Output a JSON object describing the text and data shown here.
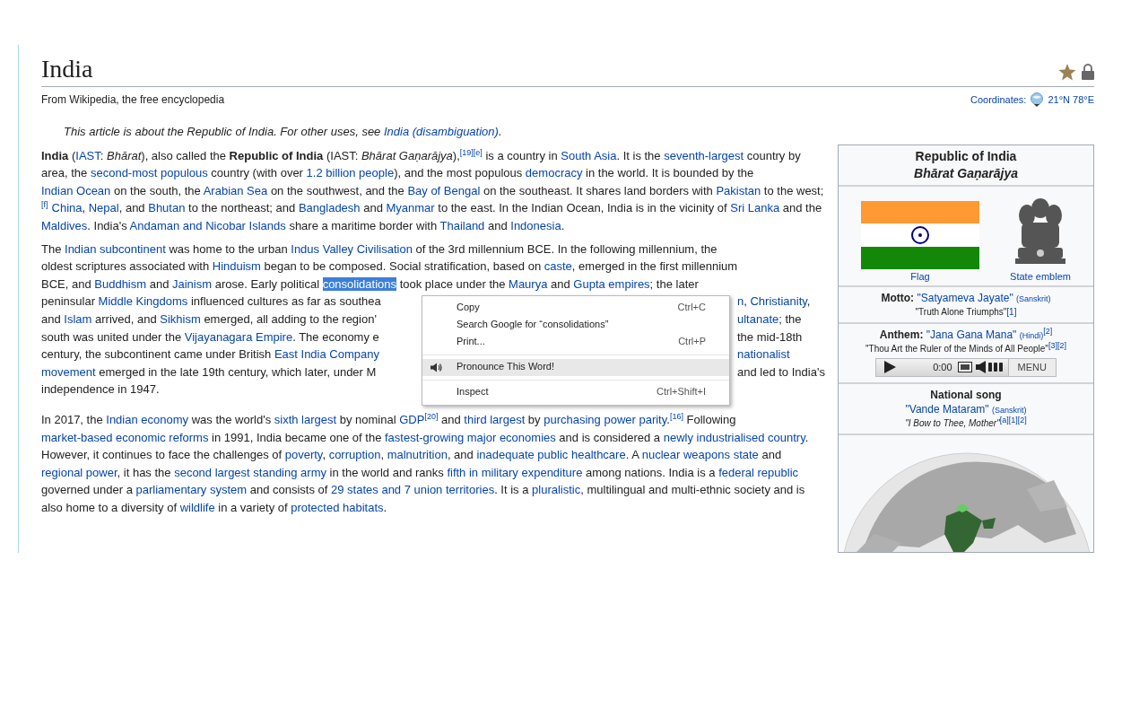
{
  "article": {
    "title": "India",
    "tagline": "From Wikipedia, the free encyclopedia",
    "coordinates": {
      "label": "Coordinates:",
      "value": "21°N 78°E"
    },
    "hatnote": [
      "This article is about the Republic of India. For other uses, see ",
      {
        "kind": "link",
        "text": "India (disambiguation)"
      },
      "."
    ],
    "paragraph_1": [
      {
        "kind": "bold",
        "text": "India"
      },
      " (",
      {
        "kind": "link",
        "text": "IAST"
      },
      ": ",
      {
        "kind": "italic",
        "text": "Bhārat"
      },
      "), also called the ",
      {
        "kind": "bold",
        "text": "Republic of India"
      },
      " (IAST: ",
      {
        "kind": "italic",
        "text": "Bhārat Gaṇarājya"
      },
      "),",
      {
        "kind": "ref",
        "text": "[19][e]"
      },
      " is a country in ",
      {
        "kind": "link",
        "text": "South Asia"
      },
      ". It is the ",
      {
        "kind": "link",
        "text": "seventh-largest"
      },
      " country by area, the ",
      {
        "kind": "link",
        "text": "second-most populous"
      },
      " country (with over ",
      {
        "kind": "link",
        "text": "1.2 billion people"
      },
      "), and the most populous ",
      {
        "kind": "link",
        "text": "democracy"
      },
      " in the world. It is bounded by the ",
      {
        "kind": "link",
        "text": "Indian Ocean"
      },
      " on the south, the ",
      {
        "kind": "link",
        "text": "Arabian Sea"
      },
      " on the southwest, and the ",
      {
        "kind": "link",
        "text": "Bay of Bengal"
      },
      " on the southeast. It shares land borders with ",
      {
        "kind": "link",
        "text": "Pakistan"
      },
      " to the west;",
      {
        "kind": "ref",
        "text": "[f]"
      },
      {
        "kind": "link",
        "text": "China"
      },
      ", ",
      {
        "kind": "link",
        "text": "Nepal"
      },
      ", and ",
      {
        "kind": "link",
        "text": "Bhutan"
      },
      " to the northeast; and ",
      {
        "kind": "link",
        "text": "Bangladesh"
      },
      " and ",
      {
        "kind": "link",
        "text": "Myanmar"
      },
      " to the east. In the Indian Ocean, India is in the vicinity of ",
      {
        "kind": "link",
        "text": "Sri Lanka"
      },
      " and the ",
      {
        "kind": "link",
        "text": "Maldives"
      },
      ". India's ",
      {
        "kind": "link",
        "text": "Andaman and Nicobar Islands"
      },
      " share a maritime border with ",
      {
        "kind": "link",
        "text": "Thailand"
      },
      " and ",
      {
        "kind": "link",
        "text": "Indonesia"
      },
      "."
    ],
    "paragraph_2_lines": [
      {
        "left": [
          "The ",
          {
            "kind": "link",
            "text": "Indian subcontinent"
          },
          " was home to the urban ",
          {
            "kind": "link",
            "text": "Indus Valley Civilisation"
          },
          " of the 3rd millennium BCE. In the following millennium, the"
        ]
      },
      {
        "left": [
          "oldest scriptures associated with ",
          {
            "kind": "link",
            "text": "Hinduism"
          },
          " began to be composed. Social stratification, based on ",
          {
            "kind": "link",
            "text": "caste"
          },
          ", emerged in the first millennium"
        ]
      },
      {
        "left": [
          "BCE, and ",
          {
            "kind": "link",
            "text": "Buddhism"
          },
          " and ",
          {
            "kind": "link",
            "text": "Jainism"
          },
          " arose. Early political ",
          {
            "kind": "selection",
            "text": "consolidations"
          },
          " took place under the ",
          {
            "kind": "link",
            "text": "Maurya"
          },
          " and ",
          {
            "kind": "link",
            "text": "Gupta empires"
          },
          "; the later"
        ]
      },
      {
        "left": [
          "peninsular ",
          {
            "kind": "link",
            "text": "Middle Kingdoms"
          },
          " influenced cultures as far as southea"
        ],
        "right": [
          {
            "kind": "link",
            "text": "n"
          },
          ", ",
          {
            "kind": "link",
            "text": "Christianity"
          },
          ","
        ]
      },
      {
        "left": [
          "and ",
          {
            "kind": "link",
            "text": "Islam"
          },
          " arrived, and ",
          {
            "kind": "link",
            "text": "Sikhism"
          },
          " emerged, all adding to the region'"
        ],
        "right": [
          {
            "kind": "link",
            "text": "ultanate"
          },
          "; the"
        ]
      },
      {
        "left": [
          "south was united under the ",
          {
            "kind": "link",
            "text": "Vijayanagara Empire"
          },
          ". The economy e"
        ],
        "right": [
          "the mid-18th"
        ]
      },
      {
        "left": [
          "century, the subcontinent came under British ",
          {
            "kind": "link",
            "text": "East India Company"
          }
        ],
        "right": [
          {
            "kind": "link",
            "text": "nationalist"
          }
        ]
      },
      {
        "left": [
          {
            "kind": "link",
            "text": "movement"
          },
          " emerged in the late 19th century, which later, under M"
        ],
        "right": [
          "and led to India's"
        ]
      },
      {
        "left": [
          "independence in 1947."
        ]
      }
    ],
    "paragraph_3": [
      "In 2017, the ",
      {
        "kind": "link",
        "text": "Indian economy"
      },
      " was the world's ",
      {
        "kind": "link",
        "text": "sixth largest"
      },
      " by nominal ",
      {
        "kind": "link",
        "text": "GDP"
      },
      {
        "kind": "ref",
        "text": "[20]"
      },
      " and ",
      {
        "kind": "link",
        "text": "third largest"
      },
      " by ",
      {
        "kind": "link",
        "text": "purchasing power parity"
      },
      ".",
      {
        "kind": "ref",
        "text": "[16]"
      },
      " Following ",
      {
        "kind": "link",
        "text": "market-based economic reforms"
      },
      " in 1991, India became one of the ",
      {
        "kind": "link",
        "text": "fastest-growing major economies"
      },
      " and is considered a ",
      {
        "kind": "link",
        "text": "newly industrialised country"
      },
      ". However, it continues to face the challenges of ",
      {
        "kind": "link",
        "text": "poverty"
      },
      ", ",
      {
        "kind": "link",
        "text": "corruption"
      },
      ", ",
      {
        "kind": "link",
        "text": "malnutrition"
      },
      ", and ",
      {
        "kind": "link",
        "text": "inadequate public healthcare"
      },
      ". A ",
      {
        "kind": "link",
        "text": "nuclear weapons state"
      },
      " and ",
      {
        "kind": "link",
        "text": "regional power"
      },
      ", it has the ",
      {
        "kind": "link",
        "text": "second largest standing army"
      },
      " in the world and ranks ",
      {
        "kind": "link",
        "text": "fifth in military expenditure"
      },
      " among nations. India is a ",
      {
        "kind": "link",
        "text": "federal republic"
      },
      " governed under a ",
      {
        "kind": "link",
        "text": "parliamentary system"
      },
      " and consists of ",
      {
        "kind": "link",
        "text": "29 states and 7 union territories"
      },
      ". It is a ",
      {
        "kind": "link",
        "text": "pluralistic"
      },
      ", multilingual and multi-ethnic society and is also home to a diversity of ",
      {
        "kind": "link",
        "text": "wildlife"
      },
      " in a variety of ",
      {
        "kind": "link",
        "text": "protected habitats"
      },
      "."
    ]
  },
  "context_menu": {
    "items": [
      {
        "kind": "item",
        "label": "Copy",
        "shortcut": "Ctrl+C",
        "selected": false
      },
      {
        "kind": "item",
        "label": "Search Google for “consolidations”",
        "selected": false
      },
      {
        "kind": "item",
        "label": "Print...",
        "shortcut": "Ctrl+P",
        "selected": false
      },
      {
        "kind": "separator"
      },
      {
        "kind": "speaker-item",
        "label": "Pronounce This Word!",
        "selected": true
      },
      {
        "kind": "separator"
      },
      {
        "kind": "item",
        "label": "Inspect",
        "shortcut": "Ctrl+Shift+I",
        "selected": false
      }
    ]
  },
  "infobox": {
    "title": "Republic of India",
    "subtitle": "Bhārat Gaṇarājya",
    "images": [
      {
        "kind": "flag",
        "caption": "Flag"
      },
      {
        "kind": "emblem",
        "caption": "State emblem"
      }
    ],
    "motto": {
      "label": "Motto:",
      "name": "\"Satyameva Jayate\"",
      "language": "(Sanskrit)",
      "translation": "\"Truth Alone Triumphs\"",
      "refs": "[1]"
    },
    "anthem": {
      "label": "Anthem:",
      "name": "\"Jana Gana Mana\"",
      "language": "(Hindi)",
      "name_refs": "[2]",
      "translation": "\"Thou Art the Ruler of the Minds of All People\"",
      "refs": "[3][2]",
      "player": {
        "time": "0:00",
        "menu": "MENU"
      }
    },
    "national_song": {
      "label": "National song",
      "name": "\"Vande Mataram\"",
      "language": "(Sanskrit)",
      "translation": "\"I Bow to Thee, Mother\"",
      "refs": "[a][1][2]"
    }
  }
}
